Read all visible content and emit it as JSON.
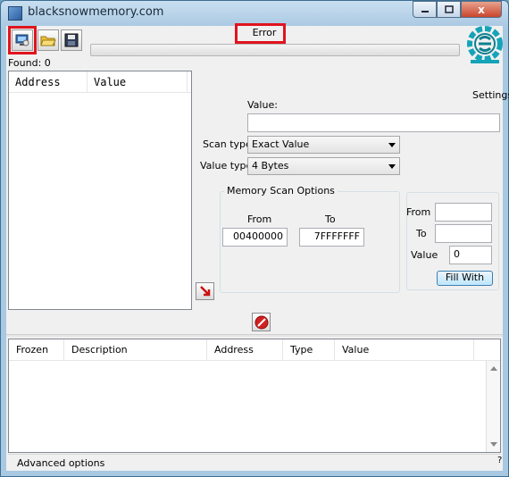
{
  "window": {
    "title": "blacksnowmemory.com",
    "close": "x"
  },
  "status": {
    "text": "Error",
    "found": "Found: 0"
  },
  "toolbar": {
    "settings_label": "Settings"
  },
  "address_list": {
    "columns": [
      "Address",
      "Value"
    ]
  },
  "scan": {
    "value_label": "Value:",
    "value": "",
    "scan_type_label": "Scan type",
    "scan_type": "Exact Value",
    "value_type_label": "Value type",
    "value_type": "4 Bytes"
  },
  "memory_options": {
    "title": "Memory Scan Options",
    "from_label": "From",
    "to_label": "To",
    "from": "00400000",
    "to": "7FFFFFFF"
  },
  "fill": {
    "from_label": "From",
    "to_label": "To",
    "value_label": "Value",
    "from": "",
    "to": "",
    "value": "0",
    "button": "Fill With"
  },
  "cheat_table": {
    "columns": [
      "Frozen",
      "Description",
      "Address",
      "Type",
      "Value"
    ]
  },
  "footer": {
    "advanced": "Advanced options",
    "grip": "?"
  },
  "colors": {
    "highlight": "#e0141e",
    "logo": "#15a3b8"
  }
}
